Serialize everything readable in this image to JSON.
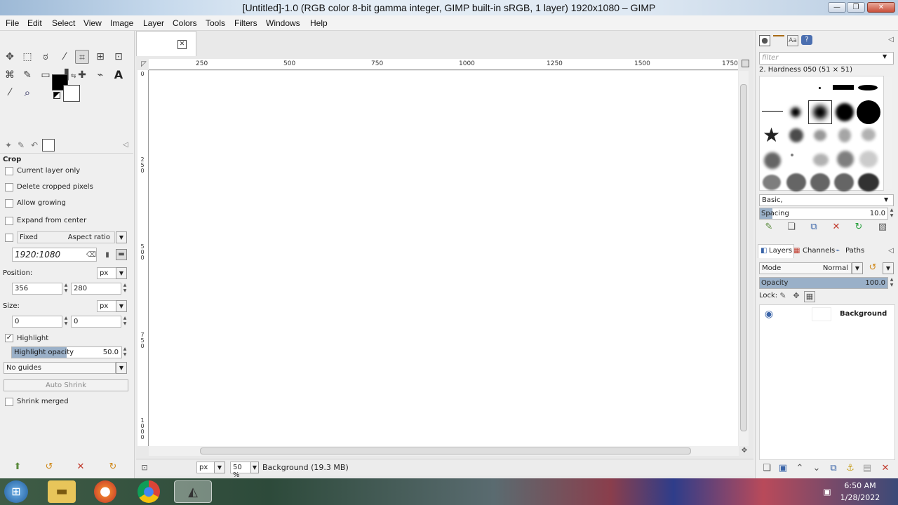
{
  "window": {
    "title": "[Untitled]-1.0 (RGB color 8-bit gamma integer, GIMP built-in sRGB, 1 layer) 1920x1080 – GIMP",
    "min_glyph": "—",
    "max_glyph": "❐",
    "close_glyph": "✕"
  },
  "menu": [
    "File",
    "Edit",
    "Select",
    "View",
    "Image",
    "Layer",
    "Colors",
    "Tools",
    "Filters",
    "Windows",
    "Help"
  ],
  "tool_options": {
    "title": "Crop",
    "current_layer_only": "Current layer only",
    "delete_cropped": "Delete cropped pixels",
    "allow_growing": "Allow growing",
    "expand_from_center": "Expand from center",
    "fixed": "Fixed",
    "aspect_ratio": "Aspect ratio",
    "ratio_value": "1920:1080",
    "position_label": "Position:",
    "position_unit": "px",
    "position_x": "356",
    "position_y": "280",
    "size_label": "Size:",
    "size_unit": "px",
    "size_w": "0",
    "size_h": "0",
    "highlight": "Highlight",
    "highlight_opacity_label": "Highlight opacity",
    "highlight_opacity_value": "50.0",
    "guides": "No guides",
    "auto_shrink": "Auto Shrink",
    "shrink_merged": "Shrink merged",
    "highlight_checked": "✓",
    "highlight_opacity_fraction": 0.5
  },
  "ruler": {
    "h": [
      "250",
      "500",
      "750",
      "1000",
      "1250",
      "1500",
      "1750"
    ],
    "v_top": "0",
    "v": [
      [
        "2",
        "5",
        "0"
      ],
      [
        "5",
        "0",
        "0"
      ],
      [
        "7",
        "5",
        "0"
      ],
      [
        "1",
        "0",
        "0",
        "0"
      ]
    ]
  },
  "status": {
    "unit": "px",
    "zoom": "50 %",
    "info": "Background (19.3 MB)"
  },
  "brushes": {
    "filter_placeholder": "filter",
    "selected_name": "2. Hardness 050 (51 × 51)",
    "tag": "Basic,",
    "spacing_label": "Spacing",
    "spacing_value": "10.0",
    "spacing_fraction": 0.1
  },
  "layers": {
    "tabs": [
      "Layers",
      "Channels",
      "Paths"
    ],
    "mode_label": "Mode",
    "mode_value": "Normal",
    "opacity_label": "Opacity",
    "opacity_value": "100.0",
    "opacity_fraction": 1.0,
    "lock_label": "Lock:",
    "layer_name": "Background"
  },
  "taskbar": {
    "time": "6:50 AM",
    "date": "1/28/2022"
  }
}
